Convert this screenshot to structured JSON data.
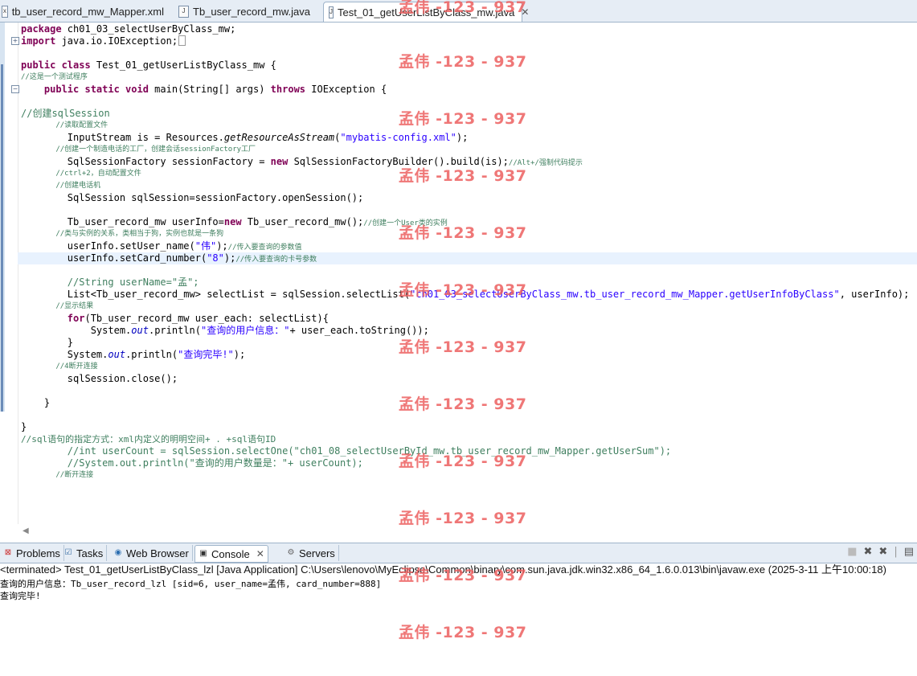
{
  "editor_tabs": [
    {
      "label": "tb_user_record_mw_Mapper.xml",
      "icon": "x"
    },
    {
      "label": "Tb_user_record_mw.java",
      "icon": "J"
    },
    {
      "label": "Test_01_getUserListByClass_mw.java",
      "icon": "J",
      "close": "✕"
    }
  ],
  "code": {
    "l1a": "package",
    "l1b": " ch01_03_selectUserByClass_mw;",
    "l2a": "import",
    "l2b": " java.io.IOException;",
    "l4a": "public class",
    "l4b": " Test_01_getUserListByClass_mw {",
    "l5": "//这是一个测试程序",
    "l6a": "    public static void",
    "l6b": " main(String[] args) ",
    "l6c": "throws",
    "l6d": " IOException {",
    "l8": "//创建sqlSession",
    "l9": "        //读取配置文件",
    "l10a": "        InputStream is = Resources.",
    "l10b": "getResourceAsStream",
    "l10c": "(",
    "l10d": "\"mybatis-config.xml\"",
    "l10e": ");",
    "l11": "        //创建一个制造电话的工厂，创建会话sessionFactory工厂",
    "l12a": "        SqlSessionFactory sessionFactory = ",
    "l12b": "new",
    "l12c": " SqlSessionFactoryBuilder().build(is);",
    "l12d": "//Alt+/强制代码提示",
    "l13": "        //ctrl+2，自动配置文件",
    "l14": "        //创建电话机",
    "l15": "        SqlSession sqlSession=sessionFactory.openSession();",
    "l17a": "        Tb_user_record_mw userInfo=",
    "l17b": "new",
    "l17c": " Tb_user_record_mw();",
    "l17d": "//创建一个User类的实例",
    "l18": "        //类与实例的关系，类相当于狗，实例也就是一条狗",
    "l19a": "        userInfo.setUser_name(",
    "l19b": "\"伟\"",
    "l19c": ");",
    "l19d": "//传入要查询的参数值",
    "l20a": "        userInfo.setCard_number(",
    "l20b": "\"8\"",
    "l20c": ");",
    "l20d": "//传入要查询的卡号参数",
    "l22": "        //String userName=\"孟\";",
    "l23a": "        List<Tb_user_record_mw> selectList = sqlSession.selectList(",
    "l23b": "\"ch01_03_selectUserByClass_mw.tb_user_record_mw_Mapper.getUserInfoByClass\"",
    "l23c": ", userInfo);",
    "l24": "        //显示结果",
    "l25a": "        ",
    "l25b": "for",
    "l25c": "(Tb_user_record_mw user_each: selectList){",
    "l26a": "            System.",
    "l26b": "out",
    "l26c": ".println(",
    "l26d": "\"查询的用户信息：\"",
    "l26e": "+ user_each.toString());",
    "l27": "        }",
    "l28a": "        System.",
    "l28b": "out",
    "l28c": ".println(",
    "l28d": "\"查询完毕!\"",
    "l28e": ");",
    "l29": "        //4断开连接",
    "l30": "        sqlSession.close();",
    "l32": "    }",
    "l34": "}",
    "l35": "//sql语句的指定方式：xml内定义的明明空间+ . +sql语句ID",
    "l36": "        //int userCount = sqlSession.selectOne(\"ch01_08_selectUserById_mw.tb_user_record_mw_Mapper.getUserSum\");",
    "l37": "        //System.out.println(\"查询的用户数量是：\"+ userCount);",
    "l38": "        //断开连接"
  },
  "view_tabs": [
    {
      "label": "Problems",
      "icon": "problems-icon"
    },
    {
      "label": "Tasks",
      "icon": "tasks-icon"
    },
    {
      "label": "Web Browser",
      "icon": "globe-icon"
    },
    {
      "label": "Console",
      "icon": "console-icon",
      "close": "✕"
    },
    {
      "label": "Servers",
      "icon": "servers-icon"
    }
  ],
  "console": {
    "header": "<terminated> Test_01_getUserListByClass_lzl [Java Application] C:\\Users\\lenovo\\MyEclipse\\Common\\binary\\com.sun.java.jdk.win32.x86_64_1.6.0.013\\bin\\javaw.exe (2025-3-11 上午10:00:18)",
    "line1": "查询的用户信息：Tb_user_record_lzl [sid=6, user_name=孟伟, card_number=888]",
    "line2": "查询完毕!"
  },
  "watermark": "孟伟 -123 - 937"
}
